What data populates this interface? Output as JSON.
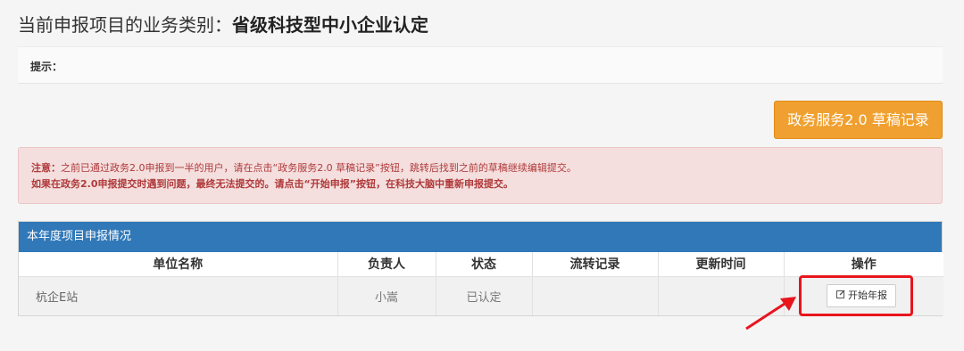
{
  "header": {
    "title_prefix": "当前申报项目的业务类别：",
    "title_value": "省级科技型中小企业认定"
  },
  "tip": {
    "label": "提示："
  },
  "draft_button": {
    "label": "政务服务2.0 草稿记录",
    "color": "#f0a030"
  },
  "notice": {
    "line1_label": "注意：",
    "line1_text": "之前已通过政务2.0申报到一半的用户，请在点击“政务服务2.0 草稿记录”按钮，跳转后找到之前的草稿继续编辑提交。",
    "line2_text": "如果在政务2.0申报提交时遇到问题，最终无法提交的。请点击“开始申报”按钮，在科技大脑中重新申报提交。"
  },
  "panel": {
    "title": "本年度项目申报情况",
    "header_color": "#3078b8",
    "columns": [
      "单位名称",
      "负责人",
      "状态",
      "流转记录",
      "更新时间",
      "操作"
    ],
    "rows": [
      {
        "unit": "杭企E站",
        "owner": "小嵩",
        "status": "已认定",
        "flow": "",
        "updated": "",
        "action": "开始年报"
      }
    ]
  },
  "icons": {
    "action_icon": "edit-icon",
    "annotation": "red-arrow-icon"
  },
  "highlight_color": "#e8151d"
}
